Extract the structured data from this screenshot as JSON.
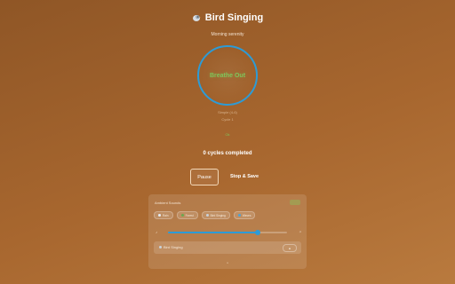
{
  "header": {
    "title": "Bird Singing",
    "subtitle": "Morning serenity"
  },
  "breath": {
    "phase": "Breathe Out",
    "pattern": "Simple (4-6)",
    "cycle": "Cycle 1",
    "status": "Ok"
  },
  "progress": {
    "cycles_text": "0 cycles completed"
  },
  "controls": {
    "pause_label": "Pause",
    "stop_label": "Stop & Save"
  },
  "ambient": {
    "heading": "Ambient Sounds",
    "chips": [
      {
        "label": "Rain"
      },
      {
        "label": "Forest"
      },
      {
        "label": "Bird Singing"
      },
      {
        "label": "Waves"
      }
    ],
    "volume_percent": 75,
    "now_playing": "Bird Singing"
  },
  "colors": {
    "accent": "#2d9bd6",
    "phase_text": "#7fc35a"
  }
}
